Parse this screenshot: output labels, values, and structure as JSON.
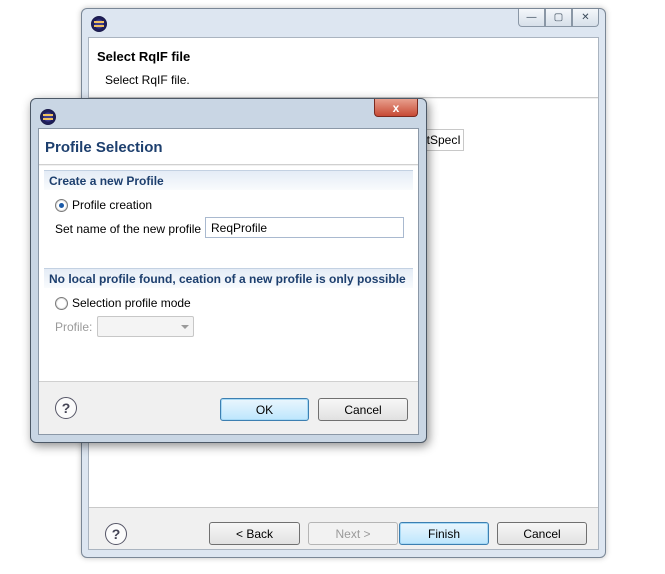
{
  "wizard": {
    "header_title": "Select RqIF file",
    "header_desc": "Select RqIF file.",
    "field_snippet": "ortSpecI",
    "buttons": {
      "back": "< Back",
      "next": "Next >",
      "finish": "Finish",
      "cancel": "Cancel"
    }
  },
  "dialog": {
    "title": "Profile Selection",
    "close_glyph": "x",
    "section_create": "Create a new Profile",
    "radio_creation": "Profile creation",
    "name_label": "Set name of the new profile",
    "name_value": "ReqProfile",
    "section_nolocal": "No local profile found, ceation of a new profile is only possible",
    "radio_selection": "Selection profile mode",
    "profile_label": "Profile:",
    "profile_value": "",
    "buttons": {
      "ok": "OK",
      "cancel": "Cancel"
    }
  },
  "icons": {
    "help_glyph": "?",
    "minimize_glyph": "—",
    "maximize_glyph": "▢",
    "close_glyph": "✕"
  }
}
